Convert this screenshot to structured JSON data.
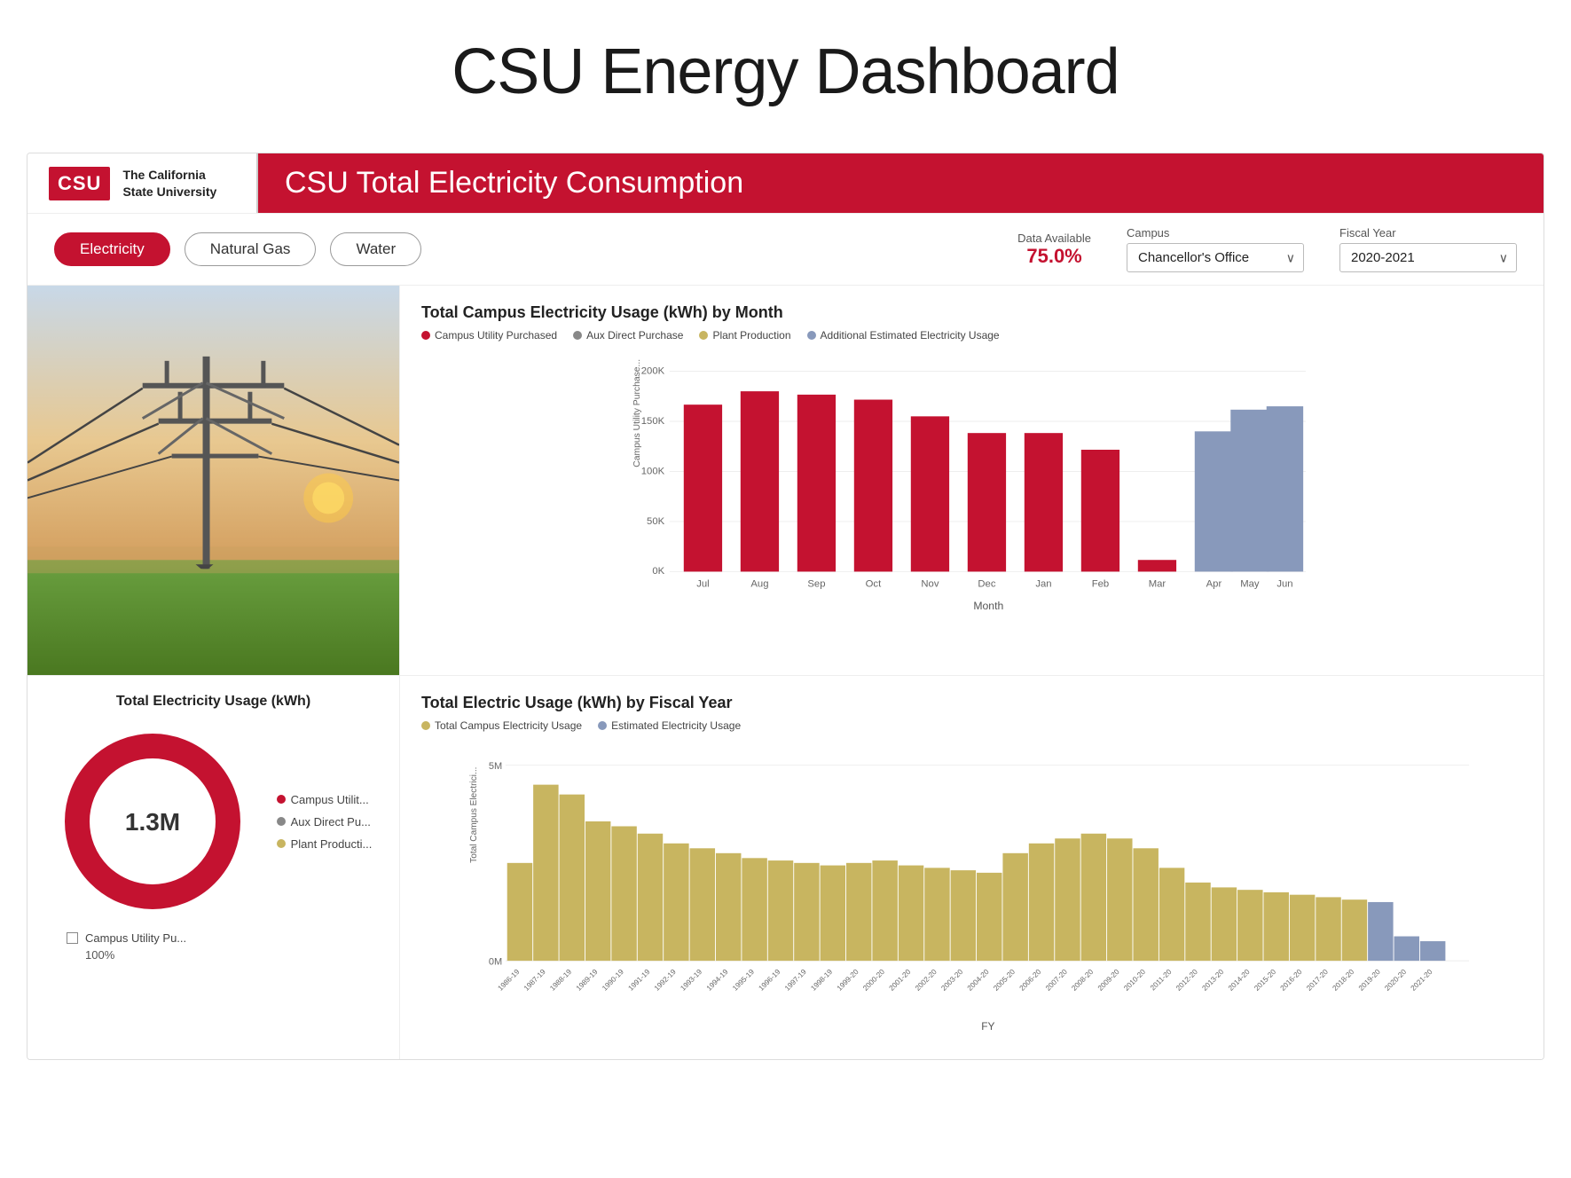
{
  "page": {
    "title": "CSU Energy Dashboard"
  },
  "header": {
    "logo_text": "CSU",
    "logo_sub": "The California\nState University",
    "chart_title": "CSU Total Electricity Consumption"
  },
  "tabs": [
    {
      "id": "electricity",
      "label": "Electricity",
      "active": true
    },
    {
      "id": "natural_gas",
      "label": "Natural Gas",
      "active": false
    },
    {
      "id": "water",
      "label": "Water",
      "active": false
    }
  ],
  "controls": {
    "data_available_label": "Data Available",
    "data_available_value": "75.0%",
    "campus_label": "Campus",
    "campus_value": "Chancellor's Office",
    "fiscal_year_label": "Fiscal Year",
    "fiscal_year_value": "2020-2021"
  },
  "monthly_chart": {
    "title": "Total Campus Electricity Usage (kWh) by Month",
    "y_axis_label": "Campus Utility Purchase...",
    "x_axis_label": "Month",
    "legend": [
      {
        "label": "Campus Utility Purchased",
        "color": "#c41230"
      },
      {
        "label": "Aux Direct Purchase",
        "color": "#888"
      },
      {
        "label": "Plant Production",
        "color": "#c8b560"
      },
      {
        "label": "Additional Estimated Electricity Usage",
        "color": "#8899bb"
      }
    ],
    "bars": [
      {
        "month": "Jul",
        "value": 175,
        "type": "red"
      },
      {
        "month": "Aug",
        "value": 180,
        "type": "red"
      },
      {
        "month": "Sep",
        "value": 178,
        "type": "red"
      },
      {
        "month": "Oct",
        "value": 172,
        "type": "red"
      },
      {
        "month": "Nov",
        "value": 155,
        "type": "red"
      },
      {
        "month": "Dec",
        "value": 138,
        "type": "red"
      },
      {
        "month": "Jan",
        "value": 138,
        "type": "red"
      },
      {
        "month": "Feb",
        "value": 122,
        "type": "red"
      },
      {
        "month": "Mar",
        "value": 12,
        "type": "red"
      },
      {
        "month": "Apr",
        "value": 140,
        "type": "blue"
      },
      {
        "month": "May",
        "value": 162,
        "type": "blue"
      },
      {
        "month": "Jun",
        "value": 165,
        "type": "blue"
      }
    ],
    "y_max": 200,
    "y_ticks": [
      "200K",
      "150K",
      "100K",
      "50K",
      "0K"
    ]
  },
  "donut_chart": {
    "title": "Total Electricity Usage (kWh)",
    "center_value": "1.3M",
    "legend": [
      {
        "label": "Campus Utilit...",
        "color": "#c41230"
      },
      {
        "label": "Aux Direct Pu...",
        "color": "#888"
      },
      {
        "label": "Plant Producti...",
        "color": "#c8b560"
      }
    ],
    "bottom_legend": [
      {
        "label": "Campus Utility Pu...",
        "pct": "100%"
      }
    ]
  },
  "fiscal_chart": {
    "title": "Total Electric Usage (kWh) by Fiscal Year",
    "x_axis_label": "FY",
    "y_axis_label": "Total Campus Electrici...",
    "legend": [
      {
        "label": "Total Campus Electricity Usage",
        "color": "#c8b560"
      },
      {
        "label": "Estimated Electricity Usage",
        "color": "#8899bb"
      }
    ],
    "y_ticks": [
      "5M",
      "0M"
    ],
    "years": [
      "1986-19",
      "1987-19",
      "1988-19",
      "1989-19",
      "1990-19",
      "1991-19",
      "1992-19",
      "1993-19",
      "1994-19",
      "1995-19",
      "1996-19",
      "1997-19",
      "1998-19",
      "1999-20",
      "2000-20",
      "2001-20",
      "2002-20",
      "2003-20",
      "2004-20",
      "2005-20",
      "2006-20",
      "2007-20",
      "2008-20",
      "2009-20",
      "2010-20",
      "2011-20",
      "2012-20",
      "2013-20",
      "2014-20",
      "2015-20",
      "2016-20",
      "2017-20",
      "2018-20",
      "2019-20",
      "2020-20",
      "2021-20"
    ],
    "values": [
      40,
      72,
      68,
      57,
      55,
      52,
      48,
      46,
      44,
      42,
      41,
      40,
      39,
      40,
      41,
      39,
      38,
      37,
      36,
      44,
      48,
      50,
      52,
      50,
      46,
      38,
      32,
      30,
      29,
      28,
      27,
      26,
      25,
      24,
      10,
      8
    ],
    "estimated_start": 33
  }
}
